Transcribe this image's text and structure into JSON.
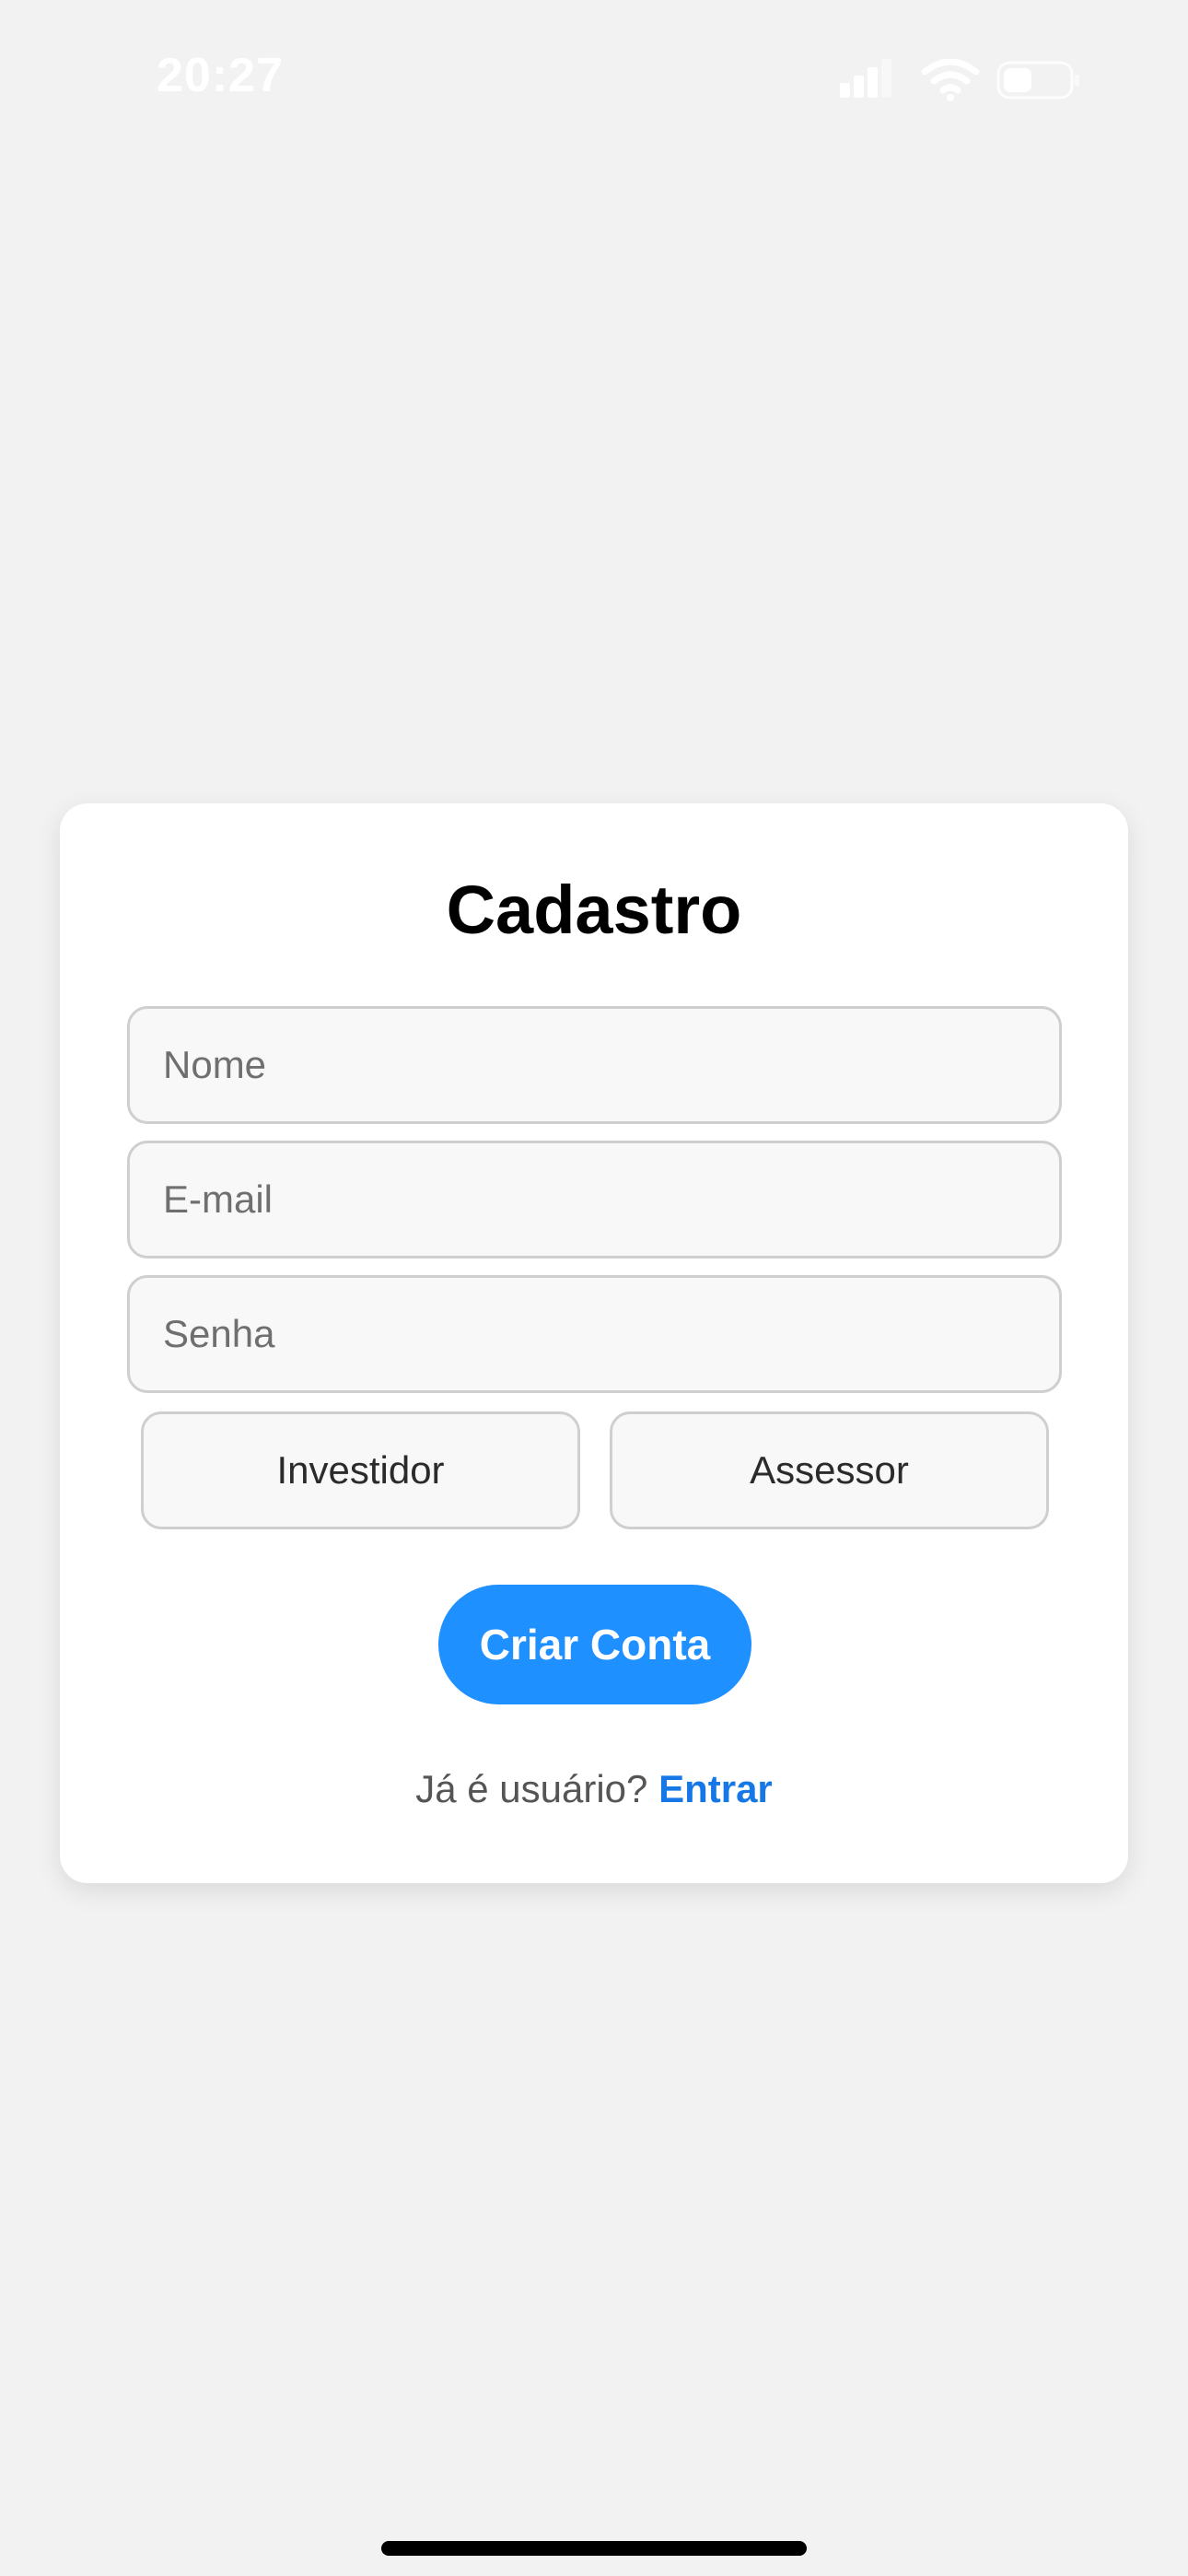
{
  "status_bar": {
    "time": "20:27",
    "icons": [
      "cellular-signal-icon",
      "wifi-icon",
      "battery-icon"
    ]
  },
  "form": {
    "title": "Cadastro",
    "name_placeholder": "Nome",
    "email_placeholder": "E-mail",
    "password_placeholder": "Senha",
    "name_value": "",
    "email_value": "",
    "password_value": "",
    "roles": [
      "Investidor",
      "Assessor"
    ],
    "submit_label": "Criar Conta",
    "login_prompt": "Já é usuário?",
    "login_link": "Entrar"
  },
  "colors": {
    "background": "#f2f2f2",
    "card": "#ffffff",
    "accent": "#1e90ff",
    "link": "#1677e6"
  }
}
